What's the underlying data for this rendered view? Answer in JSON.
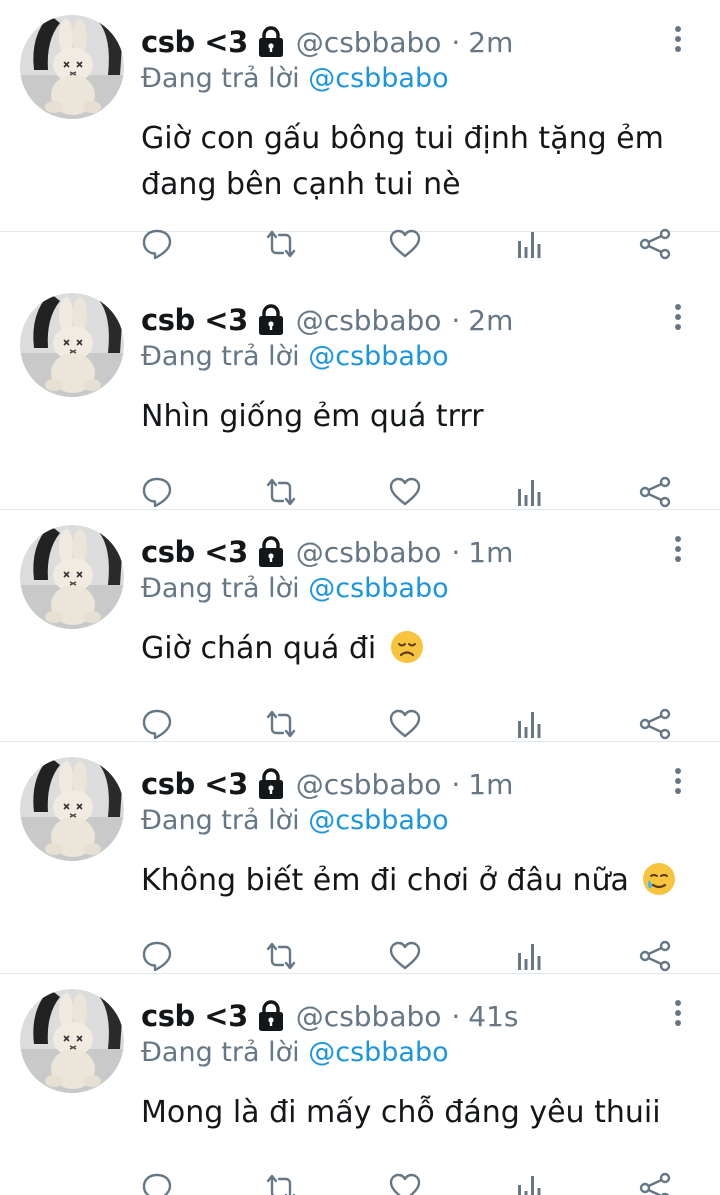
{
  "tweets": [
    {
      "name": "csb <3",
      "handle": "@csbbabo",
      "separator": "·",
      "time": "2m",
      "reply_prefix": "Đang trả lời",
      "reply_to": "@csbbabo",
      "text": "Giờ con gấu bông tui định tặng ẻm đang bên cạnh tui nè",
      "emoji": ""
    },
    {
      "name": "csb <3",
      "handle": "@csbbabo",
      "separator": "·",
      "time": "2m",
      "reply_prefix": "Đang trả lời",
      "reply_to": "@csbbabo",
      "text": "Nhìn giống ẻm quá trrr",
      "emoji": ""
    },
    {
      "name": "csb <3",
      "handle": "@csbbabo",
      "separator": "·",
      "time": "1m",
      "reply_prefix": "Đang trả lời",
      "reply_to": "@csbbabo",
      "text": "Giờ chán quá đi",
      "emoji": "disappointed-face-emoji"
    },
    {
      "name": "csb <3",
      "handle": "@csbbabo",
      "separator": "·",
      "time": "1m",
      "reply_prefix": "Đang trả lời",
      "reply_to": "@csbbabo",
      "text": "Không biết ẻm đi chơi ở đâu nữa",
      "emoji": "smiling-face-with-tear-emoji"
    },
    {
      "name": "csb <3",
      "handle": "@csbbabo",
      "separator": "·",
      "time": "41s",
      "reply_prefix": "Đang trả lời",
      "reply_to": "@csbbabo",
      "text": "Mong là đi mấy chỗ đáng yêu thuii",
      "emoji": ""
    }
  ],
  "icons": {
    "lock": "lock-icon",
    "more": "more-vertical-icon",
    "reply": "reply-icon",
    "retweet": "retweet-icon",
    "like": "heart-icon",
    "analytics": "analytics-icon",
    "share": "share-icon"
  },
  "colors": {
    "text_primary": "#14171a",
    "text_secondary": "#657786",
    "mention": "#1b95e0",
    "divider": "#e1e8ed"
  }
}
